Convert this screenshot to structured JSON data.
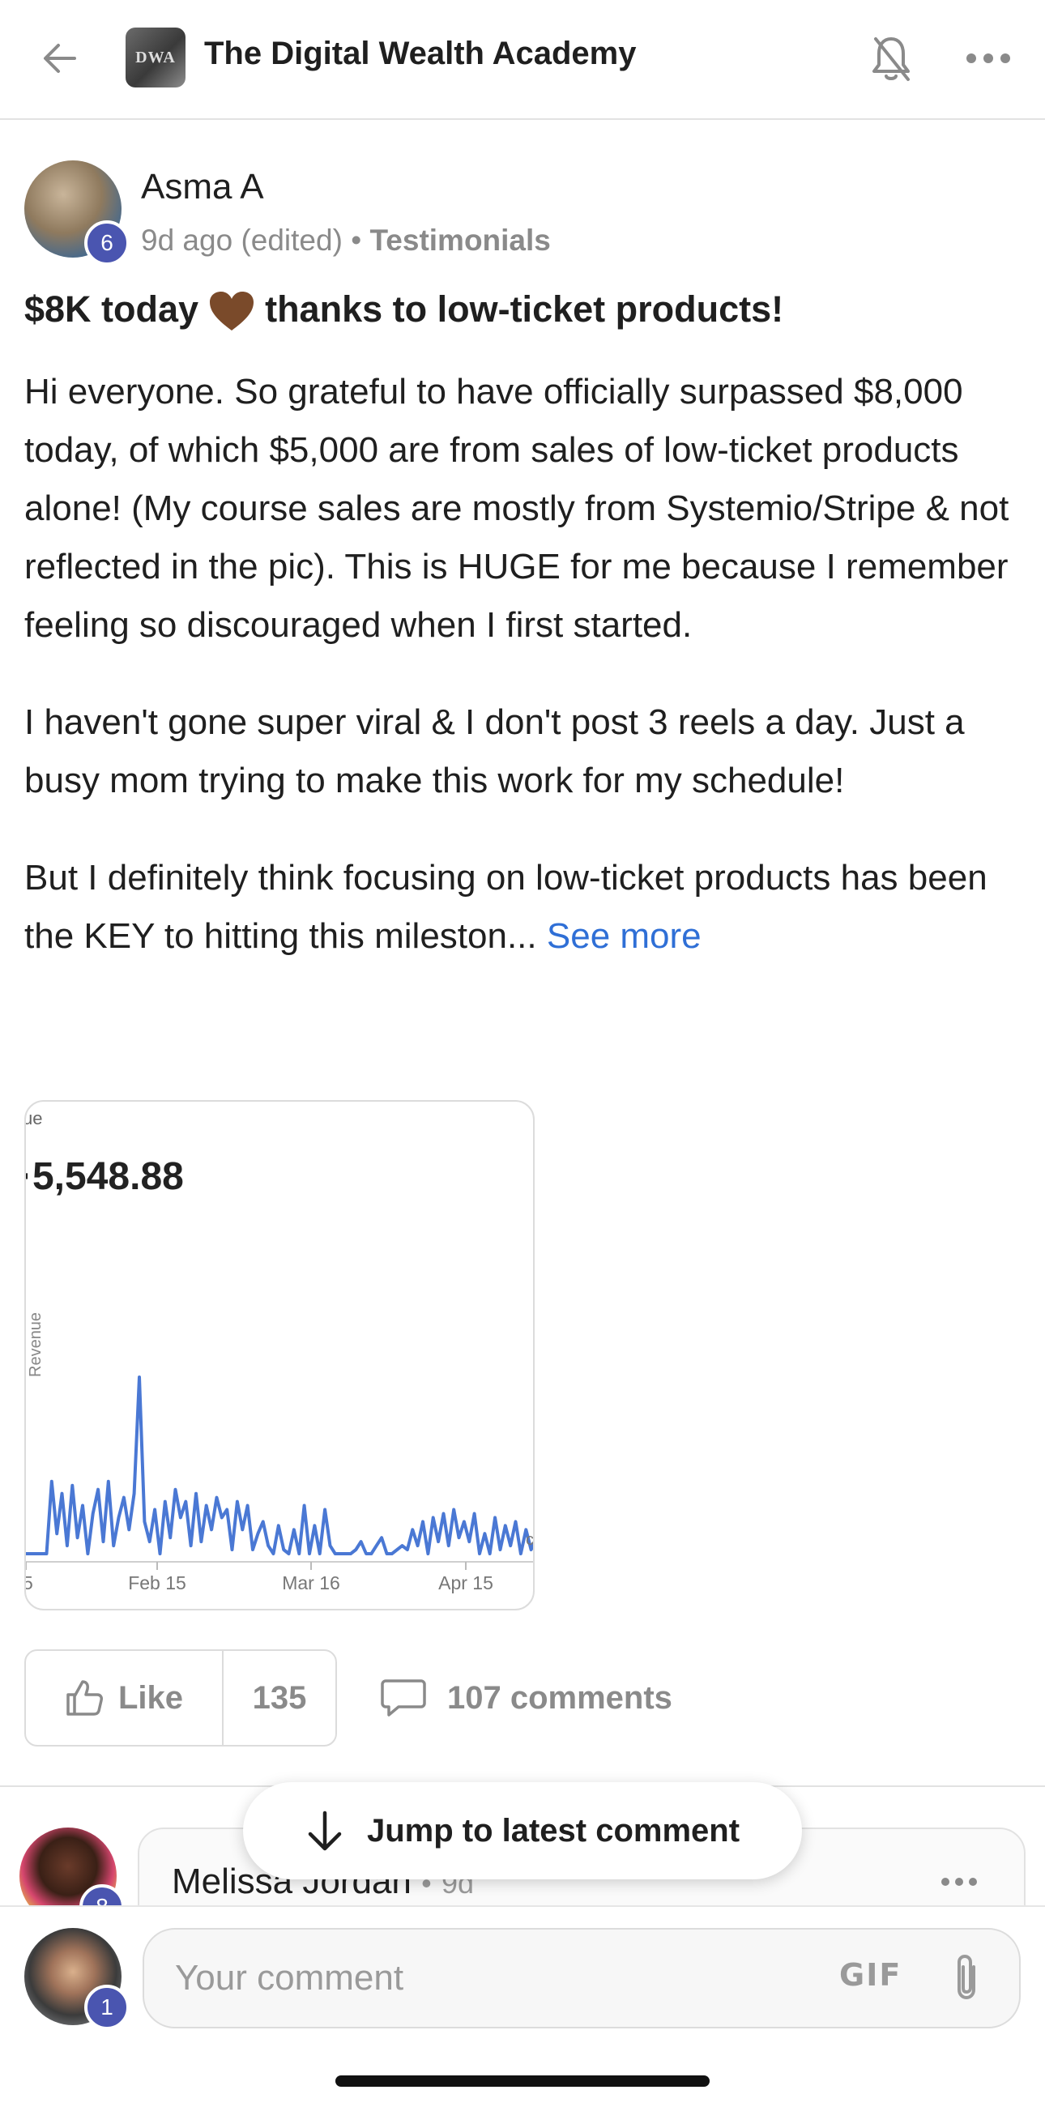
{
  "header": {
    "group_logo_text": "DWA",
    "group_title": "The Digital Wealth Academy",
    "icons": {
      "back": "back-arrow-icon",
      "bell": "bell-muted-icon",
      "more": "more-horizontal-icon"
    }
  },
  "post": {
    "author": {
      "name": "Asma A",
      "level": "6"
    },
    "meta": {
      "time": "9d ago (edited)",
      "separator": "•",
      "category": "Testimonials"
    },
    "title_before": "$8K today",
    "title_after": "thanks to low-ticket products!",
    "title_emoji": "brown-heart-icon",
    "body": [
      "Hi everyone. So grateful to have officially surpassed $8,000 today, of which $5,000 are from sales of low-ticket products alone! (My course sales are mostly from Systemio/Stripe & not reflected in the pic). This is HUGE for me because I remember feeling so discouraged when I first started.",
      "I haven't gone super viral & I don't post 3 reels a day. Just a busy mom trying to make this work for my schedule!",
      "But I definitely think focusing on low-ticket products has been the KEY to hitting this mileston..."
    ],
    "see_more": "See more",
    "attachment": {
      "crop_top_label": "ue",
      "crop_right_label": "c",
      "amount_text": "5,548.88",
      "chart_data": {
        "type": "line",
        "title": "",
        "ylabel": "Revenue",
        "x_tick_labels": [
          "5",
          "Feb 15",
          "Mar 16",
          "Apr 15"
        ],
        "series": [
          {
            "values": [
              0,
              0,
              0,
              0,
              0,
              18,
              5,
              15,
              2,
              17,
              4,
              12,
              0,
              10,
              16,
              3,
              18,
              2,
              9,
              14,
              6,
              15,
              44,
              8,
              3,
              11,
              0,
              13,
              4,
              16,
              9,
              13,
              2,
              15,
              3,
              12,
              6,
              14,
              9,
              11,
              1,
              13,
              6,
              12,
              1,
              5,
              8,
              2,
              0,
              7,
              1,
              0,
              6,
              0,
              12,
              0,
              7,
              0,
              11,
              2,
              0,
              0,
              0,
              0,
              1,
              3,
              0,
              0,
              2,
              4,
              0,
              0,
              1,
              2,
              1,
              6,
              2,
              8,
              0,
              9,
              3,
              10,
              2,
              11,
              4,
              8,
              3,
              10,
              0,
              5,
              0,
              9,
              1,
              7,
              2,
              8,
              0,
              6,
              1,
              4
            ],
            "color": "#4a78d4"
          }
        ]
      }
    },
    "actions": {
      "like_label": "Like",
      "like_count": "135",
      "comments_label": "107 comments"
    }
  },
  "comment_preview": {
    "author": "Melissa Jordan",
    "separator": "•",
    "time": "9d",
    "level": "8"
  },
  "jump_button": {
    "label": "Jump to latest comment"
  },
  "composer": {
    "placeholder": "Your comment",
    "gif_label": "GIF",
    "my_level": "1"
  },
  "colors": {
    "accent_link": "#2f6fd6",
    "level_badge": "#4a55b0",
    "chart_line": "#4a78d4"
  }
}
